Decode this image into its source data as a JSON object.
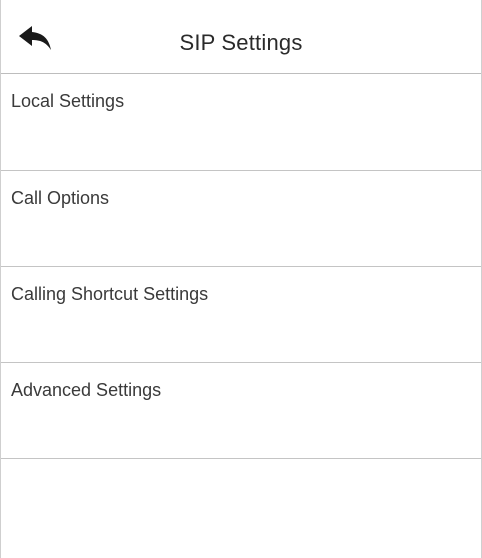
{
  "header": {
    "title": "SIP Settings",
    "back_icon": "back-arrow-icon"
  },
  "menu": {
    "items": [
      {
        "label": "Local Settings"
      },
      {
        "label": "Call Options"
      },
      {
        "label": "Calling Shortcut Settings"
      },
      {
        "label": "Advanced Settings"
      }
    ]
  },
  "colors": {
    "background": "#ffffff",
    "divider": "#c4c4c4",
    "text": "#333333"
  }
}
